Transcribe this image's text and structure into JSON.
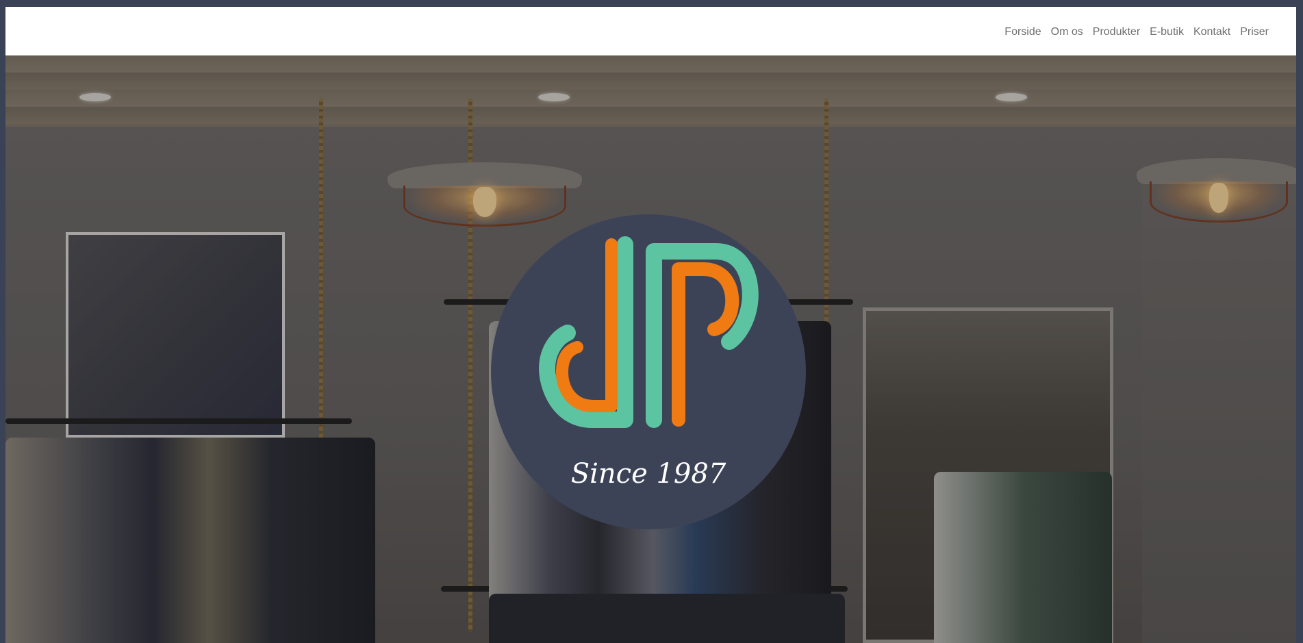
{
  "nav": {
    "items": [
      {
        "label": "Forside"
      },
      {
        "label": "Om os"
      },
      {
        "label": "Produkter"
      },
      {
        "label": "E-butik"
      },
      {
        "label": "Kontakt"
      },
      {
        "label": "Priser"
      }
    ]
  },
  "hero": {
    "logo": {
      "tagline": "Since 1987",
      "monogram_colors": {
        "teal": "#5cc4a0",
        "orange": "#f07b12",
        "circle": "#3d4357"
      }
    }
  },
  "colors": {
    "page_border": "#3a4256",
    "nav_background": "#ffffff",
    "nav_text": "#6f6f6f"
  }
}
